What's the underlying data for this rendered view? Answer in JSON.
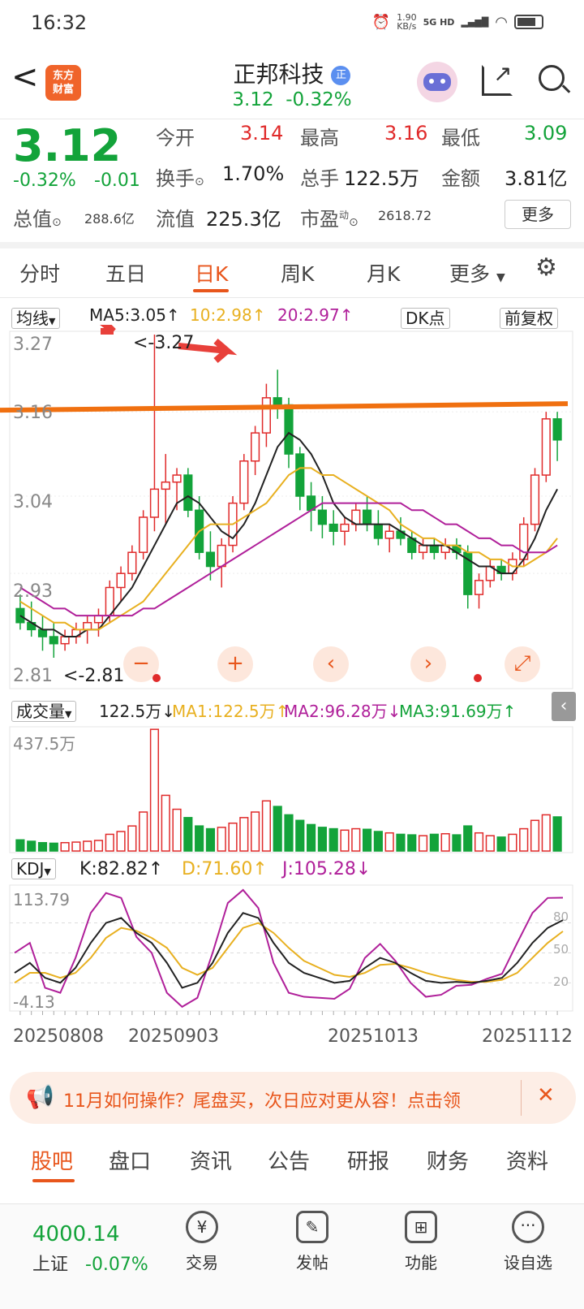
{
  "status_bar": {
    "time": "16:32",
    "net_speed_top": "1.90",
    "net_speed_bottom": "KB/s",
    "network": "5G HD"
  },
  "header": {
    "back": "<",
    "logo_line1": "东方",
    "logo_line2": "财富",
    "title": "正邦科技",
    "title_badge": "正",
    "price": "3.12",
    "change_pct": "-0.32%"
  },
  "quote": {
    "price": "3.12",
    "change_pct": "-0.32%",
    "change_abs": "-0.01",
    "open_label": "今开",
    "open": "3.14",
    "high_label": "最高",
    "high": "3.16",
    "low_label": "最低",
    "low": "3.09",
    "turnover_label": "换手",
    "turnover": "1.70%",
    "volume_label": "总手",
    "volume": "122.5万",
    "amount_label": "金额",
    "amount": "3.81亿",
    "mcap_label": "总值",
    "mcap": "288.6亿",
    "float_label": "流值",
    "float": "225.3亿",
    "pe_label": "市盈",
    "pe_sup": "动",
    "pe": "2618.72",
    "more_button": "更多"
  },
  "chart_tabs": [
    "分时",
    "五日",
    "日K",
    "周K",
    "月K",
    "更多"
  ],
  "active_tab": "日K",
  "kline_legend": {
    "ma_selector": "均线",
    "ma5": "MA5:3.05↑",
    "ma10": "10:2.98↑",
    "ma20": "20:2.97↑",
    "dk_button": "DK点",
    "adjust_button": "前复权"
  },
  "kline_axis": {
    "y1": "3.27",
    "y2": "3.16",
    "y3": "3.04",
    "y4": "2.93",
    "y5": "2.81",
    "max_label": "<-3.27",
    "min_label": "<-2.81"
  },
  "kline_controls": [
    "−",
    "+",
    "‹",
    "›",
    "⤢"
  ],
  "volume_legend": {
    "selector": "成交量",
    "vol": "122.5万↓",
    "ma1": "MA1:122.5万↑",
    "ma2": "MA2:96.28万↓",
    "ma3": "MA3:91.69万↑",
    "axis_max": "437.5万"
  },
  "kdj_legend": {
    "selector": "KDJ",
    "k": "K:82.82↑",
    "d": "D:71.60↑",
    "j": "J:105.28↓",
    "axis_top": "113.79",
    "axis_bottom": "-4.13",
    "r80": "80",
    "r50": "50",
    "r20": "20"
  },
  "dates": [
    "20250808",
    "20250903",
    "20251013",
    "20251112"
  ],
  "banner": {
    "text": "11月如何操作？尾盘买，次日应对更从容！点击领",
    "close": "✕"
  },
  "bottom_tabs": [
    "股吧",
    "盘口",
    "资讯",
    "公告",
    "研报",
    "财务",
    "资料"
  ],
  "active_bottom_tab": "股吧",
  "index": {
    "value": "4000.14",
    "name": "上证",
    "change": "-0.07%"
  },
  "bottom_nav": [
    "交易",
    "发帖",
    "功能",
    "设自选"
  ],
  "colors": {
    "up": "#e02a2a",
    "down": "#13a33a",
    "accent": "#e8561c",
    "trendline": "#f07010",
    "ma5": "#222222",
    "ma10": "#e8b020",
    "ma20": "#b0209a"
  },
  "chart_data": {
    "type": "candlestick",
    "ohlc": [
      [
        2.88,
        2.9,
        2.85,
        2.86
      ],
      [
        2.86,
        2.89,
        2.84,
        2.85
      ],
      [
        2.85,
        2.87,
        2.82,
        2.84
      ],
      [
        2.84,
        2.86,
        2.81,
        2.83
      ],
      [
        2.83,
        2.85,
        2.82,
        2.84
      ],
      [
        2.84,
        2.86,
        2.83,
        2.85
      ],
      [
        2.85,
        2.87,
        2.83,
        2.86
      ],
      [
        2.86,
        2.88,
        2.84,
        2.87
      ],
      [
        2.87,
        2.92,
        2.86,
        2.91
      ],
      [
        2.91,
        2.94,
        2.89,
        2.93
      ],
      [
        2.93,
        2.97,
        2.92,
        2.96
      ],
      [
        2.96,
        3.02,
        2.95,
        3.01
      ],
      [
        3.01,
        3.27,
        2.99,
        3.05
      ],
      [
        3.05,
        3.1,
        3.0,
        3.06
      ],
      [
        3.06,
        3.08,
        3.02,
        3.07
      ],
      [
        3.07,
        3.08,
        3.01,
        3.02
      ],
      [
        3.02,
        3.04,
        2.95,
        2.96
      ],
      [
        2.96,
        2.99,
        2.92,
        2.94
      ],
      [
        2.94,
        2.98,
        2.91,
        2.97
      ],
      [
        2.97,
        3.04,
        2.96,
        3.03
      ],
      [
        3.03,
        3.1,
        3.02,
        3.09
      ],
      [
        3.09,
        3.14,
        3.07,
        3.13
      ],
      [
        3.13,
        3.2,
        3.11,
        3.18
      ],
      [
        3.18,
        3.22,
        3.15,
        3.17
      ],
      [
        3.17,
        3.18,
        3.08,
        3.1
      ],
      [
        3.1,
        3.11,
        3.02,
        3.04
      ],
      [
        3.04,
        3.06,
        2.99,
        3.02
      ],
      [
        3.02,
        3.04,
        2.98,
        3.0
      ],
      [
        3.0,
        3.02,
        2.97,
        2.99
      ],
      [
        2.99,
        3.01,
        2.97,
        3.0
      ],
      [
        3.0,
        3.03,
        2.99,
        3.02
      ],
      [
        3.02,
        3.04,
        2.99,
        3.0
      ],
      [
        3.0,
        3.02,
        2.97,
        2.98
      ],
      [
        2.98,
        3.0,
        2.96,
        2.99
      ],
      [
        2.99,
        3.01,
        2.97,
        2.98
      ],
      [
        2.98,
        2.99,
        2.95,
        2.96
      ],
      [
        2.96,
        2.98,
        2.95,
        2.97
      ],
      [
        2.97,
        2.98,
        2.95,
        2.96
      ],
      [
        2.96,
        2.98,
        2.95,
        2.97
      ],
      [
        2.97,
        2.98,
        2.95,
        2.96
      ],
      [
        2.96,
        2.97,
        2.88,
        2.9
      ],
      [
        2.9,
        2.93,
        2.88,
        2.92
      ],
      [
        2.92,
        2.95,
        2.91,
        2.94
      ],
      [
        2.94,
        2.95,
        2.92,
        2.93
      ],
      [
        2.93,
        2.96,
        2.92,
        2.95
      ],
      [
        2.95,
        3.01,
        2.94,
        3.0
      ],
      [
        3.0,
        3.08,
        2.99,
        3.07
      ],
      [
        3.07,
        3.16,
        3.06,
        3.15
      ],
      [
        3.15,
        3.16,
        3.09,
        3.12
      ]
    ],
    "ma5": [
      2.87,
      2.86,
      2.85,
      2.85,
      2.84,
      2.84,
      2.85,
      2.85,
      2.87,
      2.89,
      2.91,
      2.94,
      2.97,
      3.0,
      3.03,
      3.04,
      3.03,
      3.01,
      2.99,
      2.98,
      3.0,
      3.03,
      3.07,
      3.11,
      3.13,
      3.12,
      3.1,
      3.07,
      3.03,
      3.01,
      3.0,
      3.0,
      3.0,
      3.0,
      2.99,
      2.98,
      2.97,
      2.97,
      2.97,
      2.96,
      2.95,
      2.94,
      2.94,
      2.93,
      2.93,
      2.95,
      2.98,
      3.02,
      3.05
    ],
    "ma10": [
      2.89,
      2.88,
      2.87,
      2.86,
      2.86,
      2.85,
      2.85,
      2.85,
      2.86,
      2.87,
      2.88,
      2.89,
      2.91,
      2.93,
      2.95,
      2.97,
      2.99,
      3.0,
      3.0,
      3.0,
      3.01,
      3.02,
      3.03,
      3.05,
      3.07,
      3.08,
      3.08,
      3.07,
      3.07,
      3.06,
      3.05,
      3.04,
      3.03,
      3.02,
      3.0,
      2.99,
      2.98,
      2.98,
      2.97,
      2.97,
      2.96,
      2.96,
      2.95,
      2.95,
      2.94,
      2.94,
      2.95,
      2.96,
      2.98
    ],
    "ma20": [
      2.91,
      2.9,
      2.89,
      2.88,
      2.88,
      2.87,
      2.87,
      2.87,
      2.87,
      2.87,
      2.87,
      2.88,
      2.88,
      2.89,
      2.9,
      2.91,
      2.92,
      2.93,
      2.94,
      2.95,
      2.96,
      2.97,
      2.98,
      2.99,
      3.0,
      3.01,
      3.02,
      3.03,
      3.03,
      3.03,
      3.03,
      3.03,
      3.03,
      3.03,
      3.03,
      3.02,
      3.02,
      3.01,
      3.0,
      3.0,
      2.99,
      2.98,
      2.98,
      2.97,
      2.97,
      2.96,
      2.96,
      2.96,
      2.97
    ],
    "volume": [
      40,
      35,
      30,
      28,
      30,
      32,
      35,
      38,
      60,
      70,
      90,
      140,
      437,
      200,
      150,
      120,
      90,
      80,
      85,
      100,
      120,
      140,
      180,
      160,
      130,
      110,
      95,
      85,
      80,
      75,
      80,
      78,
      70,
      65,
      60,
      58,
      55,
      60,
      62,
      58,
      90,
      65,
      55,
      50,
      60,
      80,
      110,
      130,
      122.5
    ],
    "kdj_k": [
      30,
      40,
      25,
      20,
      35,
      60,
      80,
      85,
      70,
      60,
      40,
      15,
      20,
      40,
      70,
      90,
      85,
      60,
      40,
      30,
      25,
      20,
      22,
      35,
      45,
      40,
      30,
      22,
      20,
      21,
      20,
      22,
      25,
      40,
      60,
      75,
      82.82
    ],
    "kdj_d": [
      20,
      30,
      30,
      25,
      30,
      45,
      65,
      75,
      72,
      65,
      55,
      35,
      28,
      35,
      55,
      75,
      80,
      70,
      55,
      42,
      35,
      28,
      26,
      30,
      38,
      39,
      35,
      30,
      26,
      23,
      21,
      21,
      23,
      30,
      45,
      60,
      71.6
    ],
    "kdj_j": [
      50,
      60,
      15,
      10,
      45,
      90,
      110,
      105,
      66,
      50,
      10,
      -4,
      5,
      50,
      100,
      113,
      95,
      40,
      10,
      6,
      5,
      4,
      14,
      45,
      59,
      42,
      20,
      6,
      8,
      17,
      18,
      24,
      29,
      60,
      90,
      105,
      105.28
    ],
    "ylim": [
      2.81,
      3.27
    ],
    "trendline_level": 3.16
  }
}
